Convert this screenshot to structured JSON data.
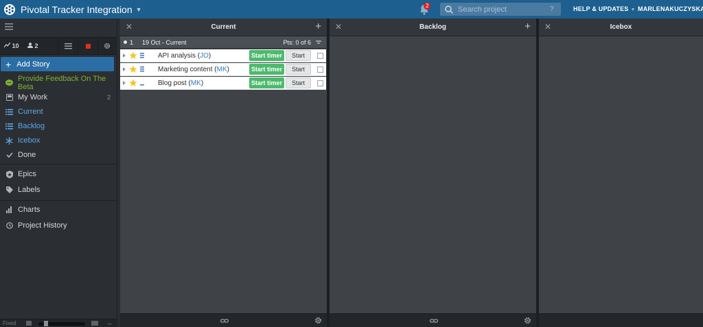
{
  "header": {
    "project_title": "Pivotal Tracker Integration",
    "notifications_count": "2",
    "search_placeholder": "Search project",
    "search_help": "?",
    "help_label": "HELP & UPDATES",
    "user_label": "MARLENAKUCZYSKA"
  },
  "sidebar": {
    "stats": {
      "velocity": "10",
      "members": "2"
    },
    "add_story_label": "Add Story",
    "items": [
      {
        "label": "Provide Feedback On The Beta",
        "icon": "chat-bubble-icon",
        "color": "#7eb32c"
      },
      {
        "label": "My Work",
        "icon": "inbox-icon",
        "count": "2"
      },
      {
        "label": "Current",
        "icon": "list-icon",
        "color": "#5ea8e6"
      },
      {
        "label": "Backlog",
        "icon": "list-icon",
        "color": "#5ea8e6"
      },
      {
        "label": "Icebox",
        "icon": "snowflake-icon",
        "color": "#5ea8e6"
      },
      {
        "label": "Done",
        "icon": "check-icon"
      },
      {
        "label": "Epics",
        "icon": "epic-icon"
      },
      {
        "label": "Labels",
        "icon": "tag-icon"
      },
      {
        "label": "Charts",
        "icon": "bar-chart-icon"
      },
      {
        "label": "Project History",
        "icon": "clock-icon"
      }
    ],
    "footer_label": "Fixed"
  },
  "panels": {
    "current": {
      "title": "Current"
    },
    "backlog": {
      "title": "Backlog"
    },
    "icebox": {
      "title": "Icebox"
    }
  },
  "iteration": {
    "number": "1",
    "label": "19 Oct - Current",
    "points": "Pts: 0 of 6"
  },
  "stories": [
    {
      "title": "API analysis",
      "owner": "JO",
      "timer_label": "Start timer",
      "start_label": "Start"
    },
    {
      "title": "Marketing content",
      "owner": "MK",
      "timer_label": "Start timer",
      "start_label": "Start"
    },
    {
      "title": "Blog post",
      "owner": "MK",
      "timer_label": "Start timer",
      "start_label": "Start"
    }
  ],
  "colors": {
    "topbar": "#1d5f8f",
    "accent_blue": "#2b6ea5",
    "timer_green": "#4cba6d",
    "star_yellow": "#f3c623"
  }
}
